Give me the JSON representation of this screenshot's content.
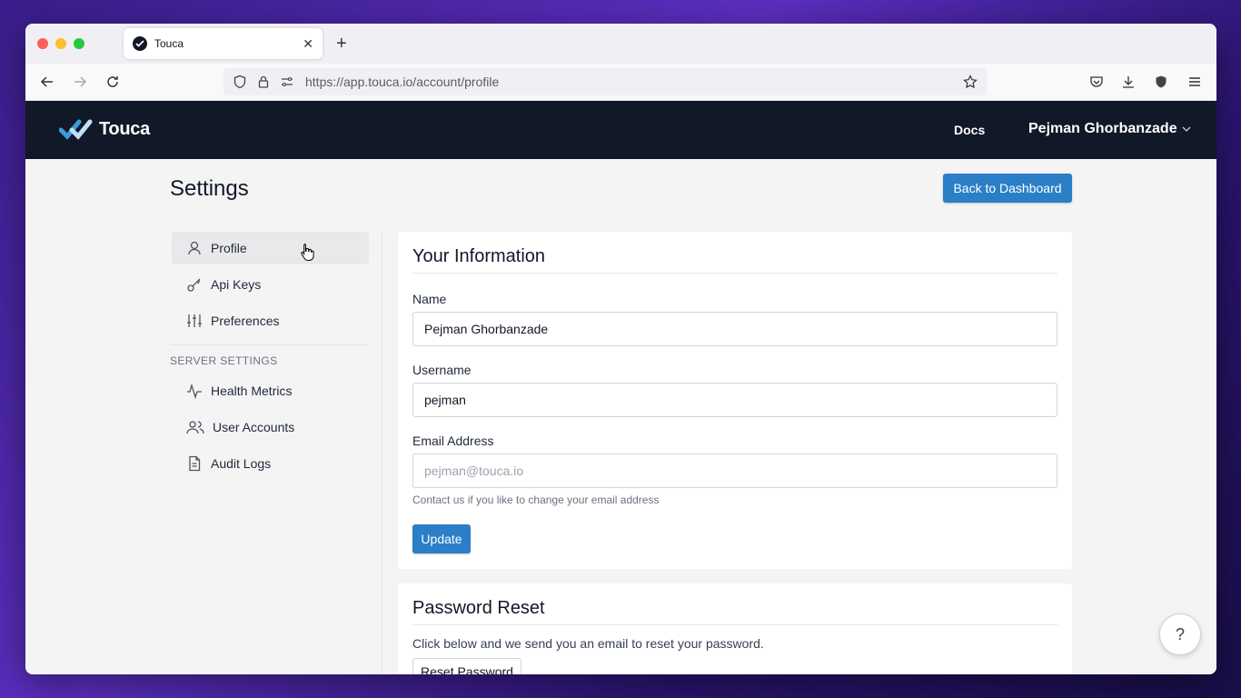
{
  "browser": {
    "tab_title": "Touca",
    "url": "https://app.touca.io/account/profile"
  },
  "header": {
    "logo_text": "Touca",
    "docs_label": "Docs",
    "user_name": "Pejman Ghorbanzade"
  },
  "page": {
    "title": "Settings",
    "back_button": "Back to Dashboard"
  },
  "sidebar": {
    "items": [
      {
        "label": "Profile",
        "icon": "user-icon",
        "active": true
      },
      {
        "label": "Api Keys",
        "icon": "key-icon"
      },
      {
        "label": "Preferences",
        "icon": "sliders-icon"
      }
    ],
    "server_header": "SERVER SETTINGS",
    "server_items": [
      {
        "label": "Health Metrics",
        "icon": "activity-icon"
      },
      {
        "label": "User Accounts",
        "icon": "users-icon"
      },
      {
        "label": "Audit Logs",
        "icon": "document-icon"
      }
    ]
  },
  "info_card": {
    "title": "Your Information",
    "name_label": "Name",
    "name_value": "Pejman Ghorbanzade",
    "username_label": "Username",
    "username_value": "pejman",
    "email_label": "Email Address",
    "email_value": "pejman@touca.io",
    "email_help": "Contact us if you like to change your email address",
    "update_button": "Update"
  },
  "password_card": {
    "title": "Password Reset",
    "description": "Click below and we send you an email to reset your password.",
    "reset_button": "Reset Password"
  },
  "help_button": "?",
  "colors": {
    "header_bg": "#111827",
    "accent": "#2a7fc6"
  }
}
